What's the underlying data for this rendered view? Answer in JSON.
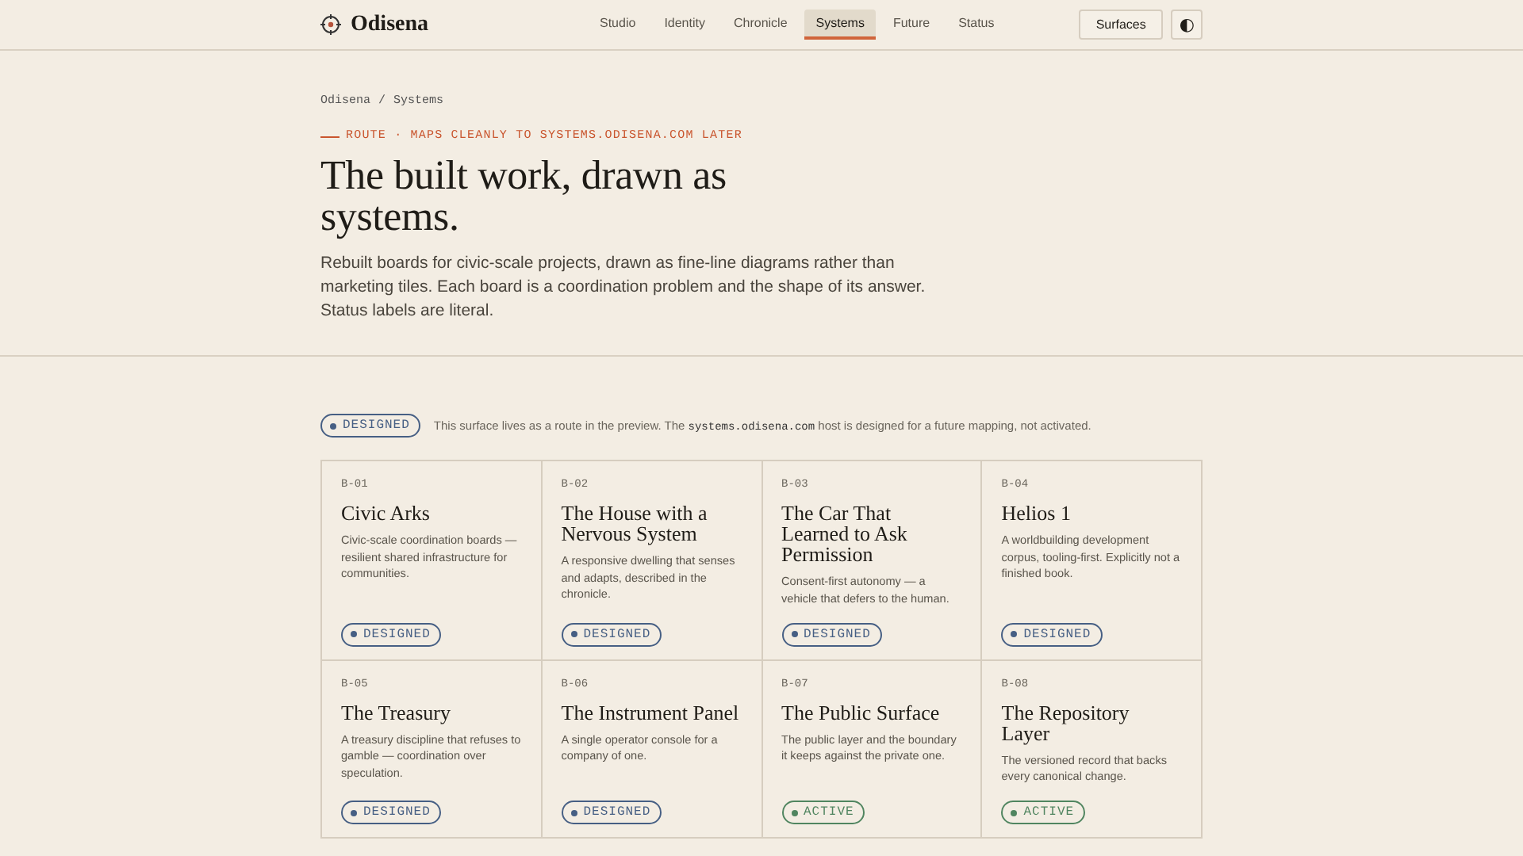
{
  "header": {
    "brand": "Odisena",
    "nav": [
      {
        "label": "Studio",
        "selected": false
      },
      {
        "label": "Identity",
        "selected": false
      },
      {
        "label": "Chronicle",
        "selected": false
      },
      {
        "label": "Systems",
        "selected": true
      },
      {
        "label": "Future",
        "selected": false
      },
      {
        "label": "Status",
        "selected": false
      }
    ],
    "surfaces_button": "Surfaces",
    "theme_toggle": "◐"
  },
  "breadcrumb": [
    "Odisena",
    "/",
    "Systems"
  ],
  "route_label": "ROUTE · MAPS CLEANLY TO SYSTEMS.ODISENA.COM LATER",
  "title": "The built work, drawn as systems.",
  "intro": "Rebuilt boards for civic-scale projects, drawn as fine-line diagrams rather than marketing tiles. Each board is a coordination problem and the shape of its answer. Status labels are literal.",
  "notice": {
    "status": {
      "kind": "designed",
      "label": "DESIGNED"
    },
    "before": "This surface lives as a route in the preview. The ",
    "code": "systems.odisena.com",
    "after": " host is designed for a future mapping, not activated."
  },
  "boards": [
    {
      "id": "B-01",
      "title": "Civic Arks",
      "description": "Civic-scale coordination boards — resilient shared infrastructure for communities.",
      "status": {
        "kind": "designed",
        "label": "DESIGNED"
      }
    },
    {
      "id": "B-02",
      "title": "The House with a Nervous System",
      "description": "A responsive dwelling that senses and adapts, described in the chronicle.",
      "status": {
        "kind": "designed",
        "label": "DESIGNED"
      }
    },
    {
      "id": "B-03",
      "title": "The Car That Learned to Ask Permission",
      "description": "Consent-first autonomy — a vehicle that defers to the human.",
      "status": {
        "kind": "designed",
        "label": "DESIGNED"
      }
    },
    {
      "id": "B-04",
      "title": "Helios 1",
      "description": "A worldbuilding development corpus, tooling-first. Explicitly not a finished book.",
      "status": {
        "kind": "designed",
        "label": "DESIGNED"
      }
    },
    {
      "id": "B-05",
      "title": "The Treasury",
      "description": "A treasury discipline that refuses to gamble — coordination over speculation.",
      "status": {
        "kind": "designed",
        "label": "DESIGNED"
      }
    },
    {
      "id": "B-06",
      "title": "The Instrument Panel",
      "description": "A single operator console for a company of one.",
      "status": {
        "kind": "designed",
        "label": "DESIGNED"
      }
    },
    {
      "id": "B-07",
      "title": "The Public Surface",
      "description": "The public layer and the boundary it keeps against the private one.",
      "status": {
        "kind": "active",
        "label": "ACTIVE"
      }
    },
    {
      "id": "B-08",
      "title": "The Repository Layer",
      "description": "The versioned record that backs every canonical change.",
      "status": {
        "kind": "active",
        "label": "ACTIVE"
      }
    }
  ]
}
